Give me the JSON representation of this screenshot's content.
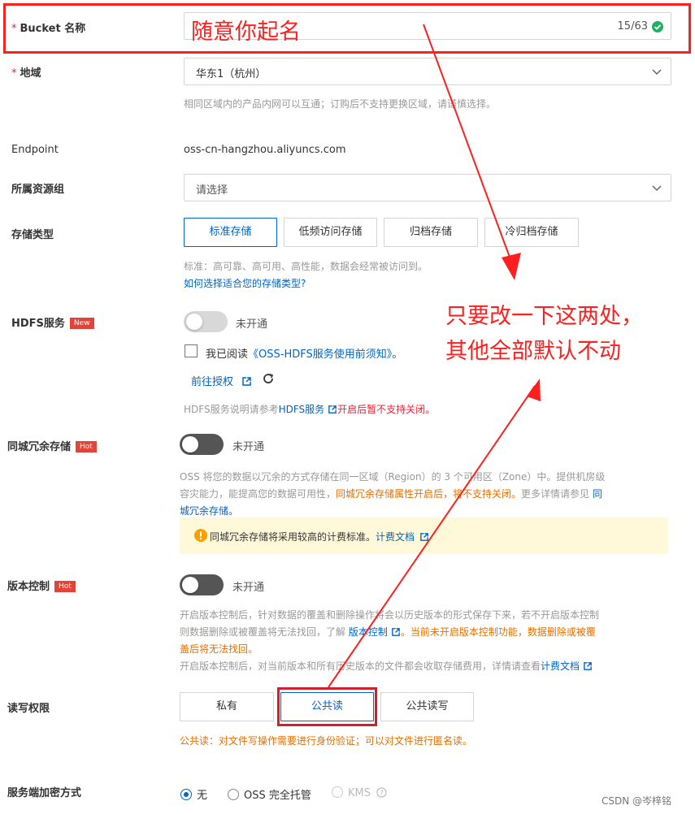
{
  "bucket": {
    "label": "Bucket 名称",
    "required_mark": "*",
    "value": "···",
    "counter": "15/63",
    "annotation": "随意你起名"
  },
  "region": {
    "label": "地域",
    "required_mark": "*",
    "value": "华东1（杭州）",
    "help": "相同区域内的产品内网可以互通；订购后不支持更换区域，请谨慎选择。"
  },
  "endpoint": {
    "label": "Endpoint",
    "value": "oss-cn-hangzhou.aliyuncs.com"
  },
  "resource_group": {
    "label": "所属资源组",
    "placeholder": "请选择"
  },
  "storage_type": {
    "label": "存储类型",
    "options": [
      "标准存储",
      "低频访问存储",
      "归档存储",
      "冷归档存储"
    ],
    "selected": "标准存储",
    "help": "标准：高可靠、高可用、高性能，数据会经常被访问到。",
    "help_link": "如何选择适合您的存储类型?"
  },
  "hdfs": {
    "label": "HDFS服务",
    "badge": "New",
    "toggle_text": "未开通",
    "checkbox_text": "我已阅读",
    "checkbox_link": "《OSS-HDFS服务使用前须知》",
    "checkbox_suffix": "。",
    "authorize_link": "前往授权",
    "help_prefix": "HDFS服务说明请参考",
    "help_link": "HDFS服务",
    "help_warn": "开启后暂不支持关闭。"
  },
  "zrs": {
    "label": "同城冗余存储",
    "badge": "Hot",
    "toggle_text": "未开通",
    "help_1": "OSS 将您的数据以冗余的方式存储在同一区域（Region）的 3 个可用区（Zone）中。提供机房级",
    "help_2a": "容灾能力，能提高您的数据可用性，",
    "help_2b": "同城冗余存储属性开启后，将不支持关闭。",
    "help_2c": "更多详情请参见",
    "help_2d": "同",
    "help_3": "城冗余存储。",
    "notice": "同城冗余存储将采用较高的计费标准。",
    "notice_link": "计费文档"
  },
  "versioning": {
    "label": "版本控制",
    "badge": "Hot",
    "toggle_text": "未开通",
    "help_1": "开启版本控制后，针对数据的覆盖和删除操作将会以历史版本的形式保存下来，若不开启版本控制",
    "help_2a": "则数据删除或被覆盖将无法找回，了解",
    "help_2b": "版本控制",
    "help_2c": "。当前未开启版本控制功能，数据删除或被覆",
    "help_3": "盖后将无法找回。",
    "help_4a": "开启版本控制后，对当前版本和所有历史版本的文件都会收取存储费用，详情请查看",
    "help_4b": "计费文档"
  },
  "acl": {
    "label": "读写权限",
    "options": [
      "私有",
      "公共读",
      "公共读写"
    ],
    "selected": "公共读",
    "help": "公共读：对文件写操作需要进行身份验证；可以对文件进行匿名读。"
  },
  "encryption": {
    "label": "服务端加密方式",
    "options": [
      "无",
      "OSS 完全托管",
      "KMS"
    ],
    "selected": "无"
  },
  "annotation_note": {
    "line1": "只要改一下这两处，",
    "line2": "其他全部默认不动"
  },
  "watermark": "CSDN @岑梓铭",
  "colors": {
    "accent": "#0064c8",
    "annotation_red": "#ff1f1f",
    "success": "#23b066",
    "warning_bg": "#fff8d9",
    "warning": "#f5a100"
  }
}
